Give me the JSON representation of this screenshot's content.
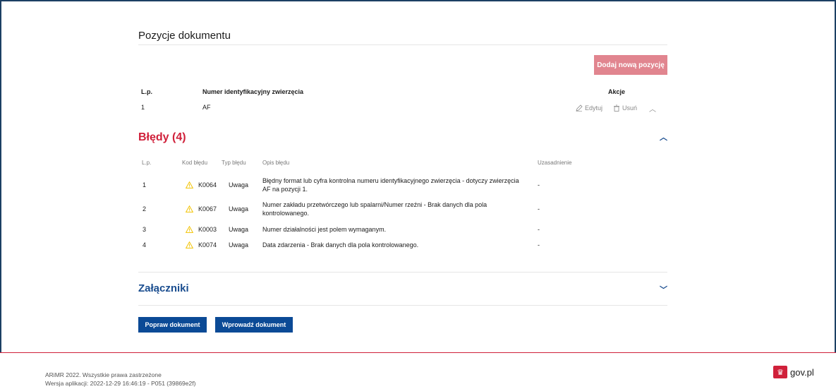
{
  "positions": {
    "title": "Pozycje dokumentu",
    "add_button": "Dodaj nową pozycję",
    "headers": {
      "lp": "L.p.",
      "number": "Numer identyfikacyjny zwierzęcia",
      "actions": "Akcje"
    },
    "rows": [
      {
        "lp": "1",
        "number": "AF",
        "edit": "Edytuj",
        "delete": "Usuń"
      }
    ]
  },
  "errors": {
    "title": "Błędy (4)",
    "headers": {
      "lp": "L.p.",
      "code": "Kod błędu",
      "type": "Typ błędu",
      "desc": "Opis błędu",
      "justification": "Uzasadnienie"
    },
    "rows": [
      {
        "lp": "1",
        "code": "K0064",
        "type": "Uwaga",
        "desc": "Błędny format lub cyfra kontrolna numeru identyfikacyjnego zwierzęcia - dotyczy zwierzęcia AF na pozycji 1.",
        "justification": "-"
      },
      {
        "lp": "2",
        "code": "K0067",
        "type": "Uwaga",
        "desc": "Numer zakładu przetwórczego lub spalarni/Numer rzeźni - Brak danych dla pola kontrolowanego.",
        "justification": "-"
      },
      {
        "lp": "3",
        "code": "K0003",
        "type": "Uwaga",
        "desc": "Numer działalności jest polem wymaganym.",
        "justification": "-"
      },
      {
        "lp": "4",
        "code": "K0074",
        "type": "Uwaga",
        "desc": "Data zdarzenia - Brak danych dla pola kontrolowanego.",
        "justification": "-"
      }
    ]
  },
  "attachments": {
    "title": "Załączniki"
  },
  "buttons": {
    "fix": "Popraw dokument",
    "submit": "Wprowadź dokument"
  },
  "footer": {
    "copyright": "ARiMR 2022. Wszystkie prawa zastrzeżone",
    "version": "Wersja aplikacji: 2022-12-29 16:46:19 - P051 (39869e2f)",
    "gov": "gov.pl"
  },
  "colors": {
    "accent_red": "#d0203a",
    "primary_blue": "#0b4a96",
    "add_button": "#e1858f",
    "warning": "#f2c200"
  }
}
